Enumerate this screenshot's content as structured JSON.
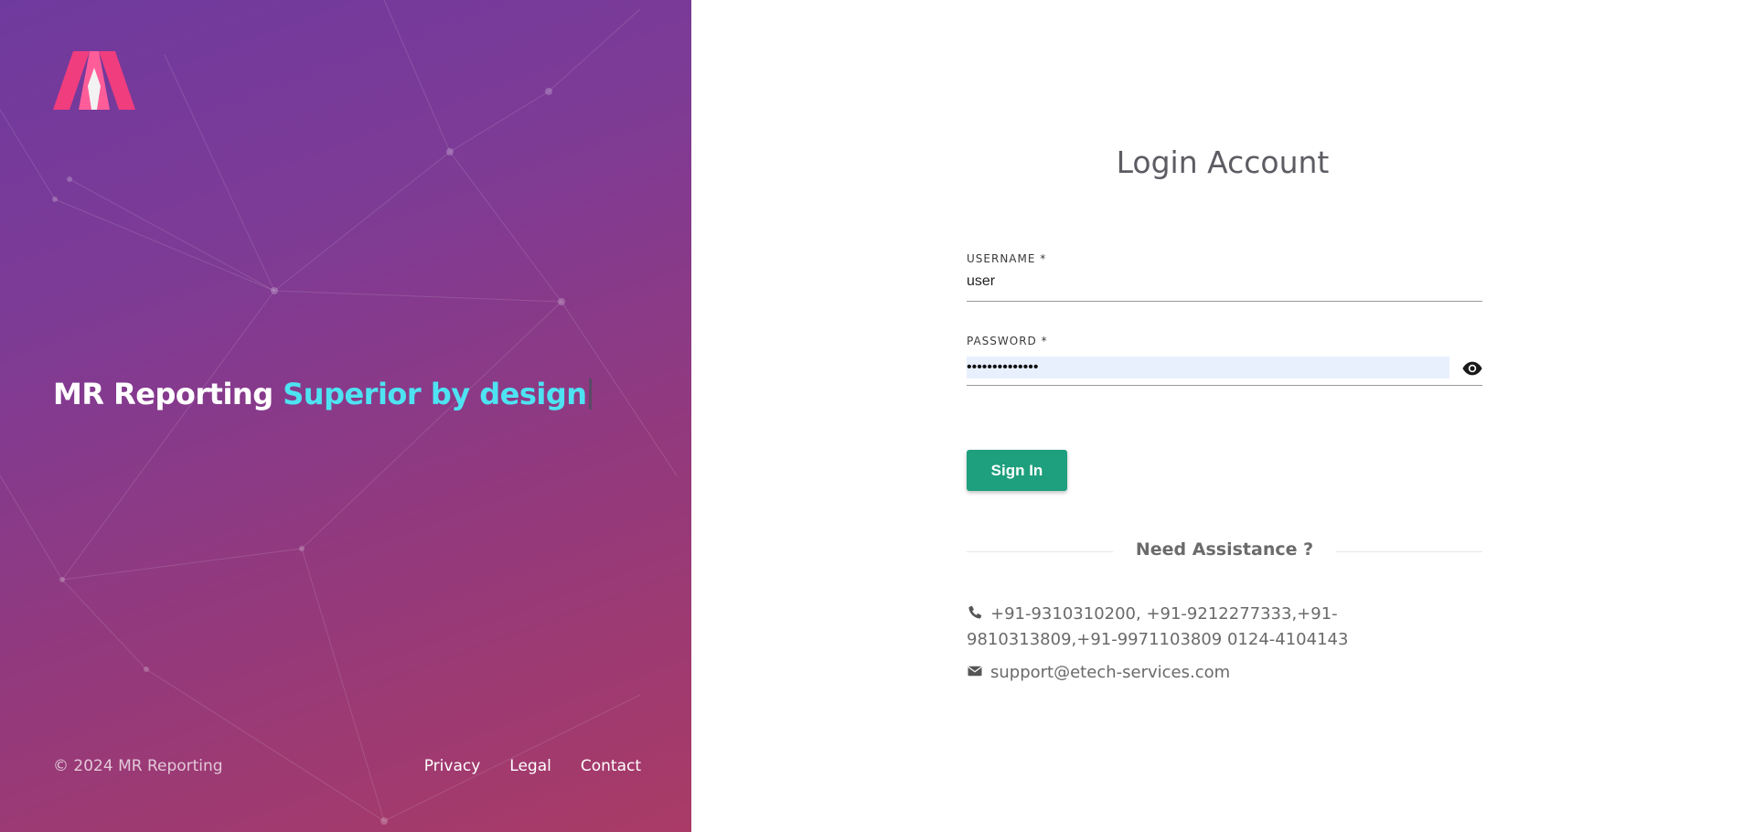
{
  "brand": {
    "tagline_main": "MR Reporting",
    "tagline_accent": "Superior by design",
    "copyright": "© 2024 MR Reporting",
    "footer_links": [
      "Privacy",
      "Legal",
      "Contact"
    ],
    "accent_color": "#4ee3f2",
    "logo_icon": "mr-logo-icon"
  },
  "login": {
    "title": "Login Account",
    "username_label": "USERNAME *",
    "username_value": "user",
    "password_label": "PASSWORD *",
    "password_value": "••••••••••••••",
    "show_password_icon": "eye-icon",
    "sign_in_label": "Sign In",
    "sign_in_color": "#1e9f7d"
  },
  "assistance": {
    "title": "Need Assistance ?",
    "phone_icon": "phone-icon",
    "phone": "+91-9310310200, +91-9212277333,+91-9810313809,+91-9971103809 0124-4104143",
    "email_icon": "envelope-icon",
    "email": "support@etech-services.com"
  }
}
